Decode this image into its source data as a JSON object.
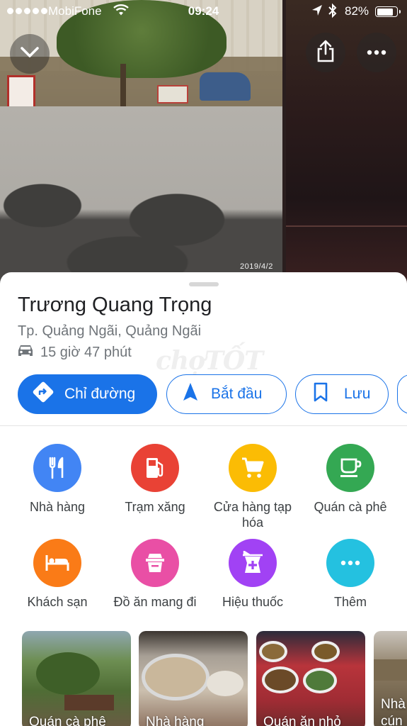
{
  "status_bar": {
    "carrier": "MobiFone",
    "time": "09:24",
    "battery": "82%",
    "battery_level": 0.82
  },
  "photos": {
    "date_stamp": "2019/4/2"
  },
  "place": {
    "name": "Trương Quang Trọng",
    "address": "Tp. Quảng Ngãi, Quảng Ngãi",
    "drive_time": "15 giờ 47 phút"
  },
  "watermark": "chợTỐT",
  "actions": {
    "directions": "Chỉ đường",
    "start": "Bắt đầu",
    "save": "Lưu"
  },
  "categories": [
    {
      "label": "Nhà hàng",
      "color": "#4285f4",
      "icon": "restaurant-icon"
    },
    {
      "label": "Trạm xăng",
      "color": "#e94235",
      "icon": "gas-station-icon"
    },
    {
      "label": "Cửa hàng tạp hóa",
      "color": "#fbbc04",
      "icon": "shopping-cart-icon"
    },
    {
      "label": "Quán cà phê",
      "color": "#34a853",
      "icon": "coffee-icon"
    },
    {
      "label": "Khách sạn",
      "color": "#fa7b17",
      "icon": "hotel-bed-icon"
    },
    {
      "label": "Đồ ăn mang đi",
      "color": "#e94fa5",
      "icon": "takeout-icon"
    },
    {
      "label": "Hiệu thuốc",
      "color": "#a142f4",
      "icon": "pharmacy-icon"
    },
    {
      "label": "Thêm",
      "color": "#24c1e0",
      "icon": "more-dots-icon"
    }
  ],
  "cards": [
    {
      "label": "Quán cà phê"
    },
    {
      "label": "Nhà hàng"
    },
    {
      "label": "Quán ăn nhỏ"
    },
    {
      "label": "Nhà cún"
    }
  ]
}
